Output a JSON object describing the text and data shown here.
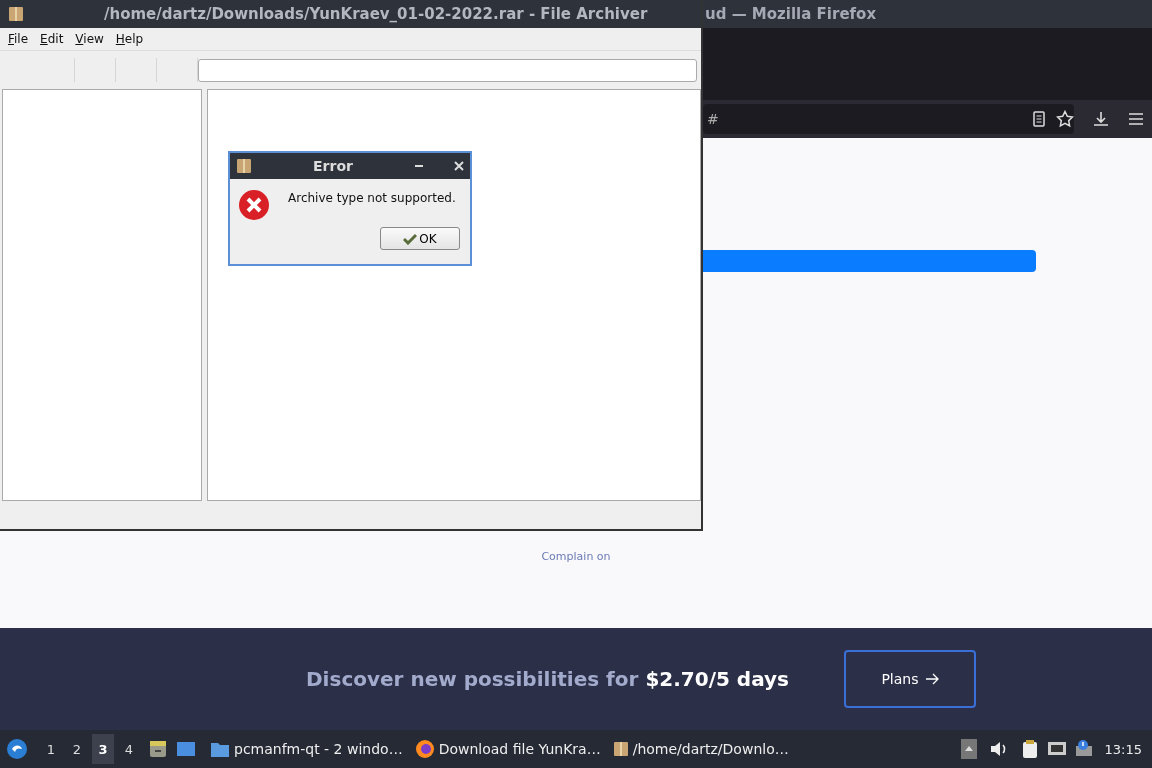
{
  "firefox": {
    "title": "ud — Mozilla Firefox",
    "url": "#",
    "link": "Complain on",
    "banner": {
      "text": "Discover new possibilities for **$2.70/5 days**",
      "button": "Plans"
    }
  },
  "archiver": {
    "title": "/home/dartz/Downloads/YunKraev_01-02-2022.rar - File Archiver",
    "menu": [
      "File",
      "Edit",
      "View",
      "Help"
    ]
  },
  "dialog": {
    "title": "Error",
    "message": "Archive type not supported.",
    "button": "OK"
  },
  "taskbar": {
    "desktops": [
      {
        "label": "1",
        "selected": false
      },
      {
        "label": "2",
        "selected": false
      },
      {
        "label": "3",
        "selected": true
      },
      {
        "label": "4",
        "selected": false
      }
    ],
    "tasks": [
      {
        "label": "pcmanfm-qt - 2 windo…",
        "kind": "folder"
      },
      {
        "label": "Download file YunKra…",
        "kind": "firefox"
      },
      {
        "label": "/home/dartz/Downlo…",
        "kind": "archive"
      }
    ],
    "clock": "13:15"
  }
}
